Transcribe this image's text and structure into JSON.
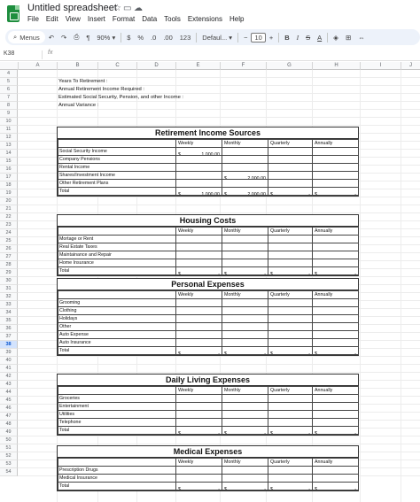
{
  "app": {
    "doc_title": "Untitled spreadsheet",
    "menu": [
      "File",
      "Edit",
      "View",
      "Insert",
      "Format",
      "Data",
      "Tools",
      "Extensions",
      "Help"
    ]
  },
  "toolbar": {
    "search_label": "Menus",
    "zoom": "90%",
    "currency": "$",
    "percent": "%",
    "dec_decrease": ".0",
    "dec_increase": ".00",
    "number_format": "123",
    "font": "Defaul...",
    "font_size": "10"
  },
  "formula_bar": {
    "cell_ref": "K38",
    "fx": "fx"
  },
  "columns": [
    "A",
    "B",
    "C",
    "D",
    "E",
    "F",
    "G",
    "H",
    "I",
    "J"
  ],
  "row_numbers": [
    "4",
    "5",
    "6",
    "7",
    "8",
    "9",
    "10",
    "11",
    "12",
    "13",
    "14",
    "15",
    "16",
    "17",
    "18",
    "19",
    "20",
    "21",
    "22",
    "23",
    "24",
    "25",
    "26",
    "27",
    "28",
    "29",
    "30",
    "31",
    "32",
    "33",
    "34",
    "35",
    "36",
    "37",
    "38",
    "39",
    "40",
    "41",
    "42",
    "43",
    "44",
    "45",
    "46",
    "47",
    "48",
    "49",
    "50",
    "51",
    "52",
    "53",
    "54"
  ],
  "selected_row": "38",
  "top_labels": [
    "Years To Retirement :",
    "Annual Retirement Income Required :",
    "Estimated Social Security, Pension, and other Income :",
    "Annual Variance :"
  ],
  "period_headers": [
    "Weekly",
    "Monthly",
    "Quarterly",
    "Annually"
  ],
  "sections": [
    {
      "title": "Retirement Income Sources",
      "rows": [
        {
          "label": "Social Security Income",
          "weekly": "1,000.00",
          "monthly": "",
          "quarterly": "",
          "annually": ""
        },
        {
          "label": "Company Pensions",
          "weekly": "",
          "monthly": "",
          "quarterly": "",
          "annually": ""
        },
        {
          "label": "Rental Income",
          "weekly": "",
          "monthly": "",
          "quarterly": "",
          "annually": ""
        },
        {
          "label": "Shares/Investment Income",
          "weekly": "",
          "monthly": "2,000.00",
          "quarterly": "",
          "annually": ""
        },
        {
          "label": "Other Retirement Plans",
          "weekly": "",
          "monthly": "",
          "quarterly": "",
          "annually": ""
        }
      ],
      "total": {
        "label": "Total",
        "weekly": "1,000.00",
        "monthly": "2,000.00",
        "quarterly": "-",
        "annually": "-"
      }
    },
    {
      "title": "Housing Costs",
      "rows": [
        {
          "label": "Mortage or Rent",
          "weekly": "",
          "monthly": "",
          "quarterly": "",
          "annually": ""
        },
        {
          "label": "Real Estate Taxes",
          "weekly": "",
          "monthly": "",
          "quarterly": "",
          "annually": ""
        },
        {
          "label": "Maintainance and Repair",
          "weekly": "",
          "monthly": "",
          "quarterly": "",
          "annually": ""
        },
        {
          "label": "Home Insurance",
          "weekly": "",
          "monthly": "",
          "quarterly": "",
          "annually": ""
        }
      ],
      "total": {
        "label": "Total",
        "weekly": "-",
        "monthly": "-",
        "quarterly": "-",
        "annually": "-"
      }
    },
    {
      "title": "Personal Expenses",
      "rows": [
        {
          "label": "Grooming",
          "weekly": "",
          "monthly": "",
          "quarterly": "",
          "annually": ""
        },
        {
          "label": "Clothing",
          "weekly": "",
          "monthly": "",
          "quarterly": "",
          "annually": ""
        },
        {
          "label": "Holidays",
          "weekly": "",
          "monthly": "",
          "quarterly": "",
          "annually": ""
        },
        {
          "label": "Other",
          "weekly": "",
          "monthly": "",
          "quarterly": "",
          "annually": ""
        },
        {
          "label": "Auto Expense",
          "weekly": "",
          "monthly": "",
          "quarterly": "",
          "annually": ""
        },
        {
          "label": "Auto Insurance",
          "weekly": "",
          "monthly": "",
          "quarterly": "",
          "annually": ""
        }
      ],
      "total": {
        "label": "Total",
        "weekly": "-",
        "monthly": "-",
        "quarterly": "-",
        "annually": "-"
      }
    },
    {
      "title": "Daily Living Expenses",
      "rows": [
        {
          "label": "Groceries",
          "weekly": "",
          "monthly": "",
          "quarterly": "",
          "annually": ""
        },
        {
          "label": "Entertainment",
          "weekly": "",
          "monthly": "",
          "quarterly": "",
          "annually": ""
        },
        {
          "label": "Utilities",
          "weekly": "",
          "monthly": "",
          "quarterly": "",
          "annually": ""
        },
        {
          "label": "Telephone",
          "weekly": "",
          "monthly": "",
          "quarterly": "",
          "annually": ""
        }
      ],
      "total": {
        "label": "Total",
        "weekly": "-",
        "monthly": "-",
        "quarterly": "-",
        "annually": "-"
      }
    },
    {
      "title": "Medical Expenses",
      "rows": [
        {
          "label": "Prescription Drugs",
          "weekly": "",
          "monthly": "",
          "quarterly": "",
          "annually": ""
        },
        {
          "label": "Medical Insurance",
          "weekly": "",
          "monthly": "",
          "quarterly": "",
          "annually": ""
        }
      ],
      "total": {
        "label": "Total",
        "weekly": "-",
        "monthly": "-",
        "quarterly": "-",
        "annually": "-"
      }
    }
  ],
  "currency_symbol": "$"
}
